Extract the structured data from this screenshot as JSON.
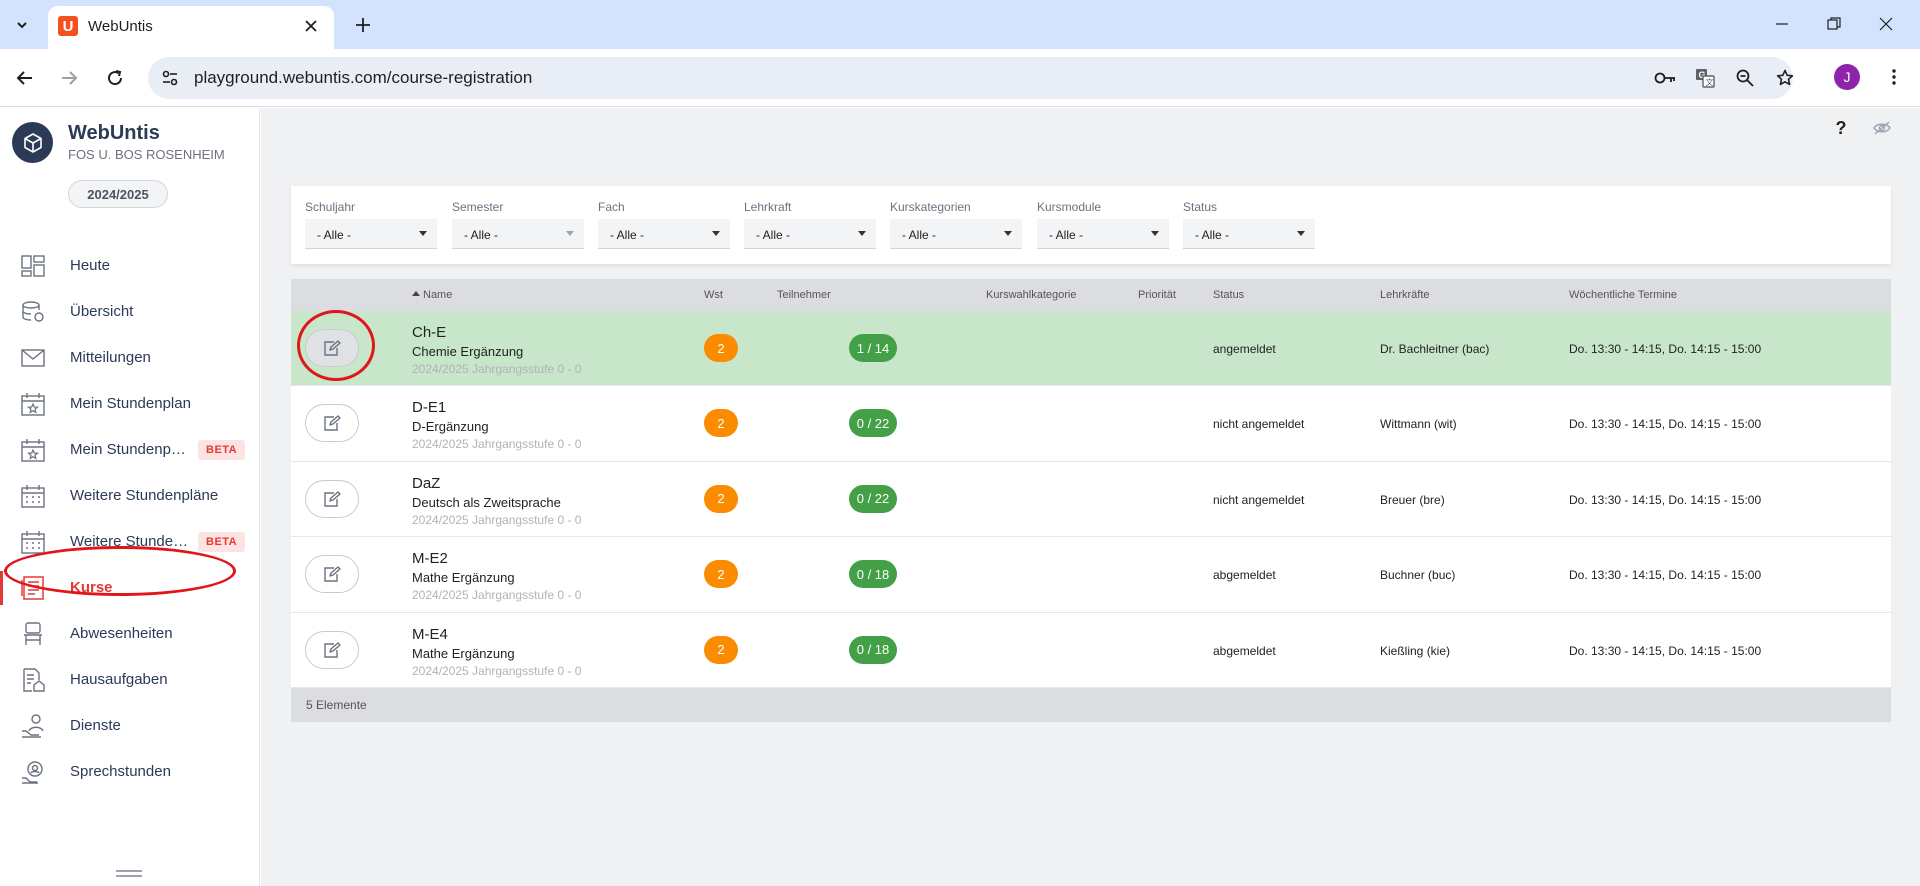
{
  "browser": {
    "tab_title": "WebUntis",
    "tab_favicon_letter": "U",
    "url": "playground.webuntis.com/course-registration",
    "profile_initial": "J"
  },
  "sidebar": {
    "app_name": "WebUntis",
    "school": "FOS U. BOS ROSENHEIM",
    "school_year": "2024/2025",
    "items": [
      {
        "label": "Heute",
        "icon": "dashboard-icon"
      },
      {
        "label": "Übersicht",
        "icon": "database-icon"
      },
      {
        "label": "Mitteilungen",
        "icon": "mail-icon"
      },
      {
        "label": "Mein Stundenplan",
        "icon": "calendar-star-icon"
      },
      {
        "label": "Mein Stundenp…",
        "icon": "calendar-star-icon",
        "badge": "BETA"
      },
      {
        "label": "Weitere Stundenpläne",
        "icon": "calendar-icon"
      },
      {
        "label": "Weitere Stunde…",
        "icon": "calendar-icon",
        "badge": "BETA"
      },
      {
        "label": "Kurse",
        "icon": "courses-icon",
        "active": true
      },
      {
        "label": "Abwesenheiten",
        "icon": "chair-icon"
      },
      {
        "label": "Hausaufgaben",
        "icon": "homework-icon"
      },
      {
        "label": "Dienste",
        "icon": "person-hand-icon"
      },
      {
        "label": "Sprechstunden",
        "icon": "consultation-icon"
      }
    ]
  },
  "header": {
    "help_label": "?"
  },
  "filters": [
    {
      "label": "Schuljahr",
      "value": "- Alle -"
    },
    {
      "label": "Semester",
      "value": "- Alle -"
    },
    {
      "label": "Fach",
      "value": "- Alle -"
    },
    {
      "label": "Lehrkraft",
      "value": "- Alle -"
    },
    {
      "label": "Kurskategorien",
      "value": "- Alle -"
    },
    {
      "label": "Kursmodule",
      "value": "- Alle -"
    },
    {
      "label": "Status",
      "value": "- Alle -"
    }
  ],
  "table": {
    "headers": {
      "name": "Name",
      "wst": "Wst",
      "participants": "Teilnehmer",
      "category": "Kurswahlkategorie",
      "priority": "Priorität",
      "status": "Status",
      "teachers": "Lehrkräfte",
      "weekly": "Wöchentliche Termine"
    },
    "rows": [
      {
        "code": "Ch-E",
        "name": "Chemie Ergänzung",
        "meta": "2024/2025  Jahrgangsstufe 0 - 0",
        "wst": "2",
        "participants": "1 / 14",
        "status": "angemeldet",
        "teacher": "Dr. Bachleitner (bac)",
        "times": "Do. 13:30 - 14:15, Do. 14:15 - 15:00"
      },
      {
        "code": "D-E1",
        "name": "D-Ergänzung",
        "meta": "2024/2025  Jahrgangsstufe 0 - 0",
        "wst": "2",
        "participants": "0 / 22",
        "status": "nicht angemeldet",
        "teacher": "Wittmann (wit)",
        "times": "Do. 13:30 - 14:15, Do. 14:15 - 15:00"
      },
      {
        "code": "DaZ",
        "name": "Deutsch als Zweitsprache",
        "meta": "2024/2025  Jahrgangsstufe 0 - 0",
        "wst": "2",
        "participants": "0 / 22",
        "status": "nicht angemeldet",
        "teacher": "Breuer (bre)",
        "times": "Do. 13:30 - 14:15, Do. 14:15 - 15:00"
      },
      {
        "code": "M-E2",
        "name": "Mathe Ergänzung",
        "meta": "2024/2025  Jahrgangsstufe 0 - 0",
        "wst": "2",
        "participants": "0 / 18",
        "status": "abgemeldet",
        "teacher": "Buchner (buc)",
        "times": "Do. 13:30 - 14:15, Do. 14:15 - 15:00"
      },
      {
        "code": "M-E4",
        "name": "Mathe Ergänzung",
        "meta": "2024/2025  Jahrgangsstufe 0 - 0",
        "wst": "2",
        "participants": "0 / 18",
        "status": "abgemeldet",
        "teacher": "Kießling (kie)",
        "times": "Do. 13:30 - 14:15, Do. 14:15 - 15:00"
      }
    ],
    "footer": "5 Elemente"
  },
  "colors": {
    "accent": "#e53935",
    "registered_row": "#c8e6c9",
    "wst_badge": "#fb8c00",
    "participants_badge": "#43a047",
    "annotation": "#e0161a"
  }
}
